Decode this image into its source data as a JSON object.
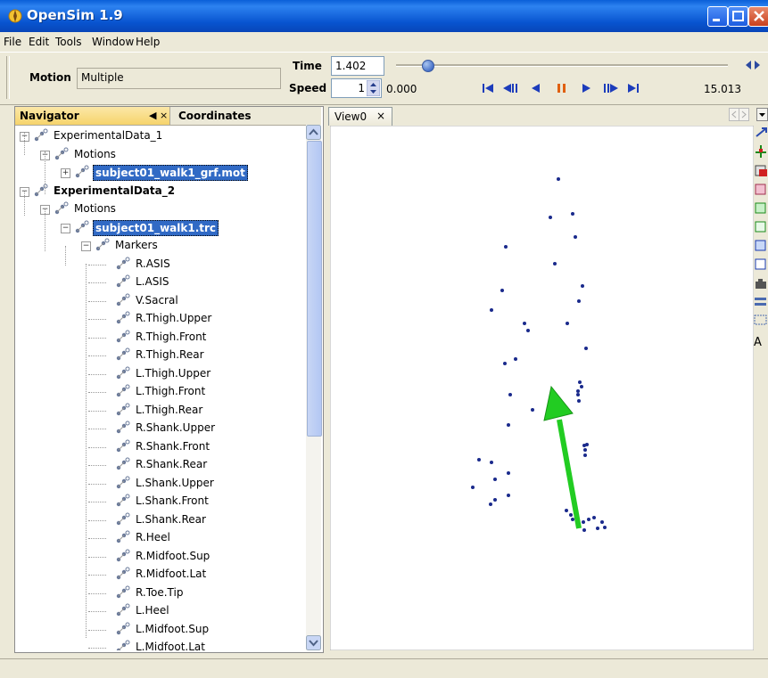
{
  "window": {
    "title": "OpenSim 1.9"
  },
  "menu": [
    "File",
    "Edit",
    "Tools",
    "Window",
    "Help"
  ],
  "toolbar": {
    "motion_label": "Motion",
    "motion_value": "Multiple",
    "time_label": "Time",
    "time_value": "1.402",
    "speed_label": "Speed",
    "speed_value": "1",
    "start_time": "0.000",
    "end_time": "15.013",
    "slider_fraction": 0.093
  },
  "navigator": {
    "tab_label": "Navigator",
    "tab_controls": "◀ ×",
    "coordinates_tab": "Coordinates",
    "tree": [
      {
        "label": "ExperimentalData_1",
        "depth": 0,
        "bold": false,
        "selected": false,
        "expander": "minus"
      },
      {
        "label": "Motions",
        "depth": 1,
        "bold": false,
        "selected": false,
        "expander": "minus"
      },
      {
        "label": "subject01_walk1_grf.mot",
        "depth": 2,
        "bold": false,
        "selected": true,
        "expander": "plus"
      },
      {
        "label": "ExperimentalData_2",
        "depth": 0,
        "bold": true,
        "selected": false,
        "expander": "minus"
      },
      {
        "label": "Motions",
        "depth": 1,
        "bold": false,
        "selected": false,
        "expander": "minus"
      },
      {
        "label": "subject01_walk1.trc",
        "depth": 2,
        "bold": false,
        "selected": true,
        "expander": "minus"
      },
      {
        "label": "Markers",
        "depth": 3,
        "bold": false,
        "selected": false,
        "expander": "minus"
      },
      {
        "label": "R.ASIS",
        "depth": 4
      },
      {
        "label": "L.ASIS",
        "depth": 4
      },
      {
        "label": "V.Sacral",
        "depth": 4
      },
      {
        "label": "R.Thigh.Upper",
        "depth": 4
      },
      {
        "label": "R.Thigh.Front",
        "depth": 4
      },
      {
        "label": "R.Thigh.Rear",
        "depth": 4
      },
      {
        "label": "L.Thigh.Upper",
        "depth": 4
      },
      {
        "label": "L.Thigh.Front",
        "depth": 4
      },
      {
        "label": "L.Thigh.Rear",
        "depth": 4
      },
      {
        "label": "R.Shank.Upper",
        "depth": 4
      },
      {
        "label": "R.Shank.Front",
        "depth": 4
      },
      {
        "label": "R.Shank.Rear",
        "depth": 4
      },
      {
        "label": "L.Shank.Upper",
        "depth": 4
      },
      {
        "label": "L.Shank.Front",
        "depth": 4
      },
      {
        "label": "L.Shank.Rear",
        "depth": 4
      },
      {
        "label": "R.Heel",
        "depth": 4
      },
      {
        "label": "R.Midfoot.Sup",
        "depth": 4
      },
      {
        "label": "R.Midfoot.Lat",
        "depth": 4
      },
      {
        "label": "R.Toe.Tip",
        "depth": 4
      },
      {
        "label": "L.Heel",
        "depth": 4
      },
      {
        "label": "L.Midfoot.Sup",
        "depth": 4
      },
      {
        "label": "L.Midfoot.Lat",
        "depth": 4
      }
    ]
  },
  "view": {
    "tab_label": "View0",
    "tab_close": "×",
    "marker_color": "#1a2a8c",
    "arrow_color": "#22cc22"
  },
  "colors": {
    "titlebar": "#0a5fd8",
    "selection": "#316ac5",
    "panel_bg": "#ece9d8"
  }
}
